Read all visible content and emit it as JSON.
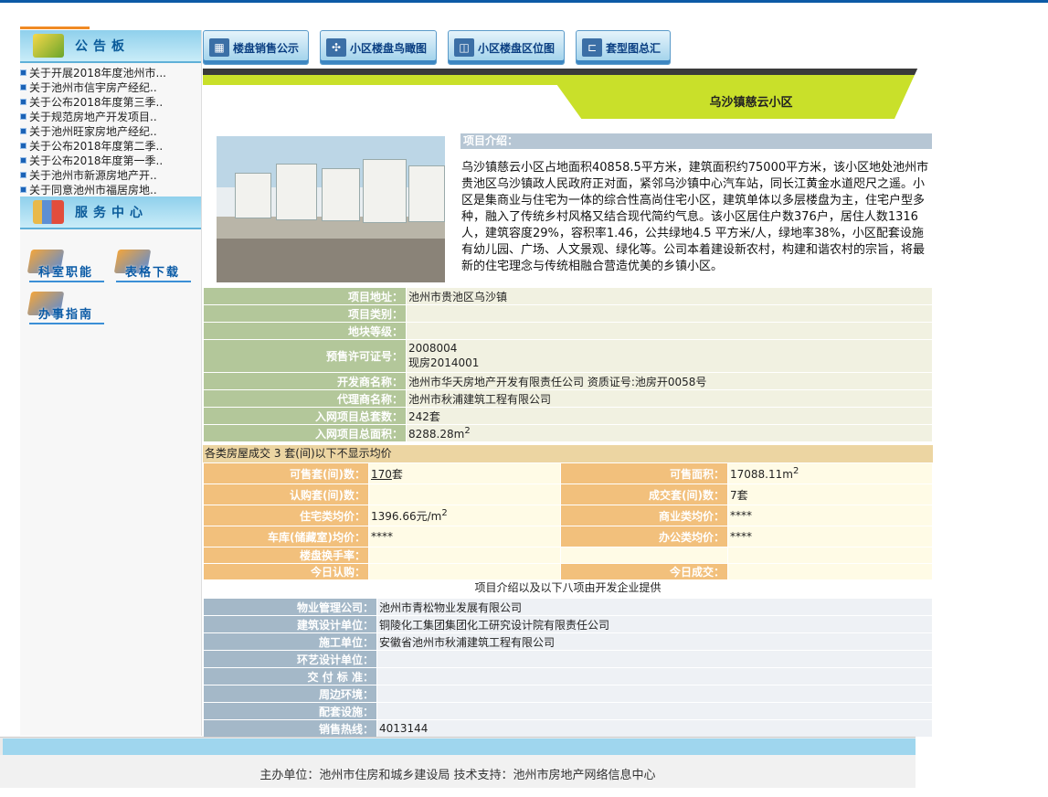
{
  "sidebar": {
    "notice_title": "公告板",
    "notices": [
      "关于开展2018年度池州市...",
      "关于池州市信宇房产经纪..",
      "关于公布2018年度第三季..",
      "关于规范房地产开发项目..",
      "关于池州旺家房地产经纪..",
      "关于公布2018年度第二季..",
      "关于公布2018年度第一季..",
      "关于池州市新源房地产开..",
      "关于同意池州市福居房地.."
    ],
    "service_title": "服务中心",
    "services": [
      "科室职能",
      "表格下载",
      "办事指南"
    ]
  },
  "toolbar": [
    "楼盘销售公示",
    "小区楼盘鸟瞰图",
    "小区楼盘区位图",
    "套型图总汇"
  ],
  "project": {
    "name": "乌沙镇慈云小区",
    "intro_label": "项目介绍：",
    "intro": "乌沙镇慈云小区占地面积40858.5平方米，建筑面积约75000平方米，该小区地处池州市贵池区乌沙镇政人民政府正对面，紧邻乌沙镇中心汽车站，同长江黄金水道咫尺之遥。小区是集商业与住宅为一体的综合性高尚住宅小区，建筑单体以多层楼盘为主，住宅户型多种，融入了传统乡村风格又结合现代简约气息。该小区居住户数376户，居住人数1316人，建筑容度29%，容积率1.46，公共绿地4.5 平方米/人，绿地率38%，小区配套设施有幼儿园、广场、人文景观、绿化等。公司本着建设新农村，构建和谐农村的宗旨，将最新的住宅理念与传统相融合营造优美的乡镇小区。"
  },
  "basic": {
    "address_label": "项目地址：",
    "address": "池州市贵池区乌沙镇",
    "type_label": "项目类别：",
    "type": "",
    "grade_label": "地块等级：",
    "grade": "",
    "permit_label": "预售许可证号：",
    "permit1": "2008004",
    "permit2": "现房2014001",
    "dev_label": "开发商名称：",
    "dev": "池州市华天房地产开发有限责任公司  资质证号:池房开0058号",
    "agent_label": "代理商名称：",
    "agent": " 池州市秋浦建筑工程有限公司",
    "units_label": "入网项目总套数：",
    "units": "242套",
    "area_label": "入网项目总面积：",
    "area": "8288.28m",
    "area_sup": "2"
  },
  "sales_note": "各类房屋成交 3 套(间)以下不显示均价",
  "sales": {
    "avail_units_label": "可售套(间)数：",
    "avail_units": "170",
    "avail_units_suffix": "套",
    "avail_area_label": "可售面积：",
    "avail_area": "17088.11m",
    "avail_area_sup": "2",
    "subscribed_label": "认购套(间)数：",
    "subscribed": "",
    "sold_label": "成交套(间)数：",
    "sold": "7套",
    "res_avg_label": "住宅类均价：",
    "res_avg": "1396.66元/m",
    "res_avg_sup": "2",
    "com_avg_label": "商业类均价：",
    "com_avg": "****",
    "garage_avg_label": "车库(储藏室)均价：",
    "garage_avg": "****",
    "office_avg_label": "办公类均价：",
    "office_avg": "****",
    "turnover_label": "楼盘换手率：",
    "turnover": "",
    "today_sub_label": "今日认购：",
    "today_sub": "",
    "today_sold_label": "今日成交：",
    "today_sold": ""
  },
  "provided_note": "项目介绍以及以下八项由开发企业提供",
  "extra": [
    {
      "label": "物业管理公司：",
      "value": "池州市青松物业发展有限公司"
    },
    {
      "label": "建筑设计单位：",
      "value": "铜陵化工集团集团化工研究设计院有限责任公司"
    },
    {
      "label": "施工单位：",
      "value": "安徽省池州市秋浦建筑工程有限公司"
    },
    {
      "label": "环艺设计单位：",
      "value": ""
    },
    {
      "label": "交 付 标 准：",
      "value": ""
    },
    {
      "label": "周边环境：",
      "value": ""
    },
    {
      "label": "配套设施：",
      "value": ""
    },
    {
      "label": "销售热线：",
      "value": "4013144"
    }
  ],
  "footer": "主办单位：池州市住房和城乡建设局      技术支持：池州市房地产网络信息中心"
}
